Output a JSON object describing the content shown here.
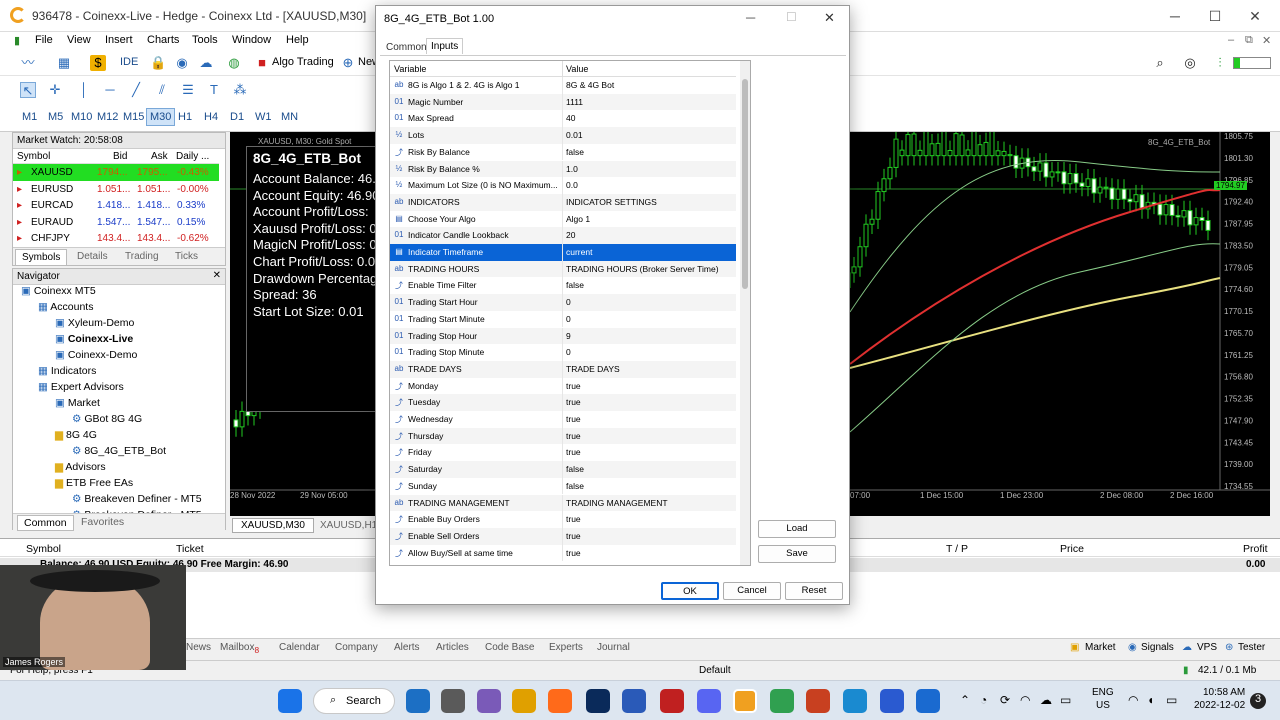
{
  "app": {
    "title": "936478 - Coinexx-Live - Hedge - Coinexx Ltd - [XAUUSD,M30]",
    "menu": [
      "File",
      "View",
      "Insert",
      "Charts",
      "Tools",
      "Window",
      "Help"
    ],
    "toolbar": {
      "algo_trading": "Algo Trading",
      "new_order": "New",
      "ide": "IDE"
    },
    "timeframes": [
      "M1",
      "M5",
      "M10",
      "M12",
      "M15",
      "M30",
      "H1",
      "H4",
      "D1",
      "W1",
      "MN"
    ],
    "active_timeframe": "M30"
  },
  "market_watch": {
    "title": "Market Watch: 20:58:08",
    "columns": [
      "Symbol",
      "Bid",
      "Ask",
      "Daily ..."
    ],
    "rows": [
      {
        "symbol": "XAUUSD",
        "bid": "1794...",
        "ask": "1795...",
        "daily": "-0.43%"
      },
      {
        "symbol": "EURUSD",
        "bid": "1.051...",
        "ask": "1.051...",
        "daily": "-0.00%"
      },
      {
        "symbol": "EURCAD",
        "bid": "1.418...",
        "ask": "1.418...",
        "daily": "0.33%"
      },
      {
        "symbol": "EURAUD",
        "bid": "1.547...",
        "ask": "1.547...",
        "daily": "0.15%"
      },
      {
        "symbol": "CHFJPY",
        "bid": "143.4...",
        "ask": "143.4...",
        "daily": "-0.62%"
      }
    ],
    "tabs": [
      "Symbols",
      "Details",
      "Trading",
      "Ticks"
    ]
  },
  "navigator": {
    "title": "Navigator",
    "items": [
      {
        "label": "Coinexx MT5",
        "level": 0
      },
      {
        "label": "Accounts",
        "level": 1
      },
      {
        "label": "Xyleum-Demo",
        "level": 2
      },
      {
        "label": "Coinexx-Live",
        "level": 2
      },
      {
        "label": "Coinexx-Demo",
        "level": 2
      },
      {
        "label": "Indicators",
        "level": 1
      },
      {
        "label": "Expert Advisors",
        "level": 1
      },
      {
        "label": "Market",
        "level": 2
      },
      {
        "label": "GBot 8G 4G",
        "level": 3
      },
      {
        "label": "8G 4G",
        "level": 2
      },
      {
        "label": "8G_4G_ETB_Bot",
        "level": 3
      },
      {
        "label": "Advisors",
        "level": 2
      },
      {
        "label": "ETB Free EAs",
        "level": 2
      },
      {
        "label": "Breakeven Definer - MT5",
        "level": 3
      },
      {
        "label": "Breakeven Definer - MT5",
        "level": 3
      }
    ],
    "tabs": [
      "Common",
      "Favorites"
    ]
  },
  "chart": {
    "symbol_label": "XAUUSD, M30: Gold Spot",
    "bot_label": "8G_4G_ETB_Bot",
    "current_price": "1794.97",
    "price_ticks": [
      "1805.75",
      "1801.30",
      "1796.85",
      "1792.40",
      "1787.95",
      "1783.50",
      "1779.05",
      "1774.60",
      "1770.15",
      "1765.70",
      "1761.25",
      "1756.80",
      "1752.35",
      "1747.90",
      "1743.45",
      "1739.00",
      "1734.55"
    ],
    "time_ticks": [
      "28 Nov 2022",
      "29 Nov 05:00",
      "07:00",
      "1 Dec 15:00",
      "1 Dec 23:00",
      "2 Dec 08:00",
      "2 Dec 16:00"
    ],
    "tabs": [
      "XAUUSD,M30",
      "XAUUSD,H1"
    ]
  },
  "overlay": {
    "title": "8G_4G_ETB_Bot",
    "lines": [
      "Account Balance: 46.",
      "Account Equity: 46.90",
      "Account Profit/Loss:",
      "Xauusd Profit/Loss: 0",
      "MagicN Profit/Loss: 0",
      "Chart Profit/Loss: 0.0",
      "Drawdown Percentag",
      "Spread: 36",
      "Start Lot Size: 0.01"
    ]
  },
  "terminal": {
    "columns": [
      "Symbol",
      "Ticket",
      "T / P",
      "Price",
      "Profit"
    ],
    "balance_line": "Balance: 46.90 USD  Equity: 46.90  Free Margin: 46.90",
    "profit_total": "0.00",
    "tabs": [
      "News",
      "Mailbox",
      "Calendar",
      "Company",
      "Alerts",
      "Articles",
      "Code Base",
      "Experts",
      "Journal"
    ],
    "mailbox_badge": "8",
    "right_items": [
      "Market",
      "Signals",
      "VPS",
      "Tester"
    ]
  },
  "status": {
    "left": "For Help, press F1",
    "center": "Default",
    "right": "42.1 / 0.1 Mb"
  },
  "webcam": {
    "name": "James Rogers"
  },
  "taskbar": {
    "search": "Search",
    "lang": "ENG",
    "region": "US",
    "time": "10:58 AM",
    "date": "2022-12-02"
  },
  "dialog": {
    "title": "8G_4G_ETB_Bot 1.00",
    "tabs": [
      "Common",
      "Inputs"
    ],
    "active_tab": "Inputs",
    "columns": [
      "Variable",
      "Value"
    ],
    "rows": [
      {
        "icon": "ab",
        "name": "8G is Algo 1 & 2. 4G is Algo 1",
        "value": "8G & 4G Bot"
      },
      {
        "icon": "01",
        "name": "Magic Number",
        "value": "1111"
      },
      {
        "icon": "01",
        "name": "Max Spread",
        "value": "40"
      },
      {
        "icon": "½",
        "name": "Lots",
        "value": "0.01"
      },
      {
        "icon": "⤴",
        "name": "Risk By Balance",
        "value": "false"
      },
      {
        "icon": "½",
        "name": "Risk By Balance %",
        "value": "1.0"
      },
      {
        "icon": "½",
        "name": "Maximum Lot Size (0 is NO Maximum...",
        "value": "0.0"
      },
      {
        "icon": "ab",
        "name": "INDICATORS",
        "value": "INDICATOR SETTINGS"
      },
      {
        "icon": "▤",
        "name": "Choose Your Algo",
        "value": "Algo 1"
      },
      {
        "icon": "01",
        "name": "Indicator Candle Lookback",
        "value": "20"
      },
      {
        "icon": "▤",
        "name": "Indicator Timeframe",
        "value": "current",
        "selected": true
      },
      {
        "icon": "ab",
        "name": "TRADING HOURS",
        "value": "TRADING HOURS (Broker Server Time)"
      },
      {
        "icon": "⤴",
        "name": "Enable Time Filter",
        "value": "false"
      },
      {
        "icon": "01",
        "name": "Trading Start Hour",
        "value": "0"
      },
      {
        "icon": "01",
        "name": "Trading Start Minute",
        "value": "0"
      },
      {
        "icon": "01",
        "name": "Trading Stop Hour",
        "value": "9"
      },
      {
        "icon": "01",
        "name": "Trading Stop Minute",
        "value": "0"
      },
      {
        "icon": "ab",
        "name": "TRADE DAYS",
        "value": "TRADE DAYS"
      },
      {
        "icon": "⤴",
        "name": "Monday",
        "value": "true"
      },
      {
        "icon": "⤴",
        "name": "Tuesday",
        "value": "true"
      },
      {
        "icon": "⤴",
        "name": "Wednesday",
        "value": "true"
      },
      {
        "icon": "⤴",
        "name": "Thursday",
        "value": "true"
      },
      {
        "icon": "⤴",
        "name": "Friday",
        "value": "true"
      },
      {
        "icon": "⤴",
        "name": "Saturday",
        "value": "false"
      },
      {
        "icon": "⤴",
        "name": "Sunday",
        "value": "false"
      },
      {
        "icon": "ab",
        "name": "TRADING MANAGEMENT",
        "value": "TRADING MANAGEMENT"
      },
      {
        "icon": "⤴",
        "name": "Enable Buy Orders",
        "value": "true"
      },
      {
        "icon": "⤴",
        "name": "Enable Sell Orders",
        "value": "true"
      },
      {
        "icon": "⤴",
        "name": "Allow Buy/Sell at same time",
        "value": "true"
      }
    ],
    "buttons": {
      "load": "Load",
      "save": "Save",
      "ok": "OK",
      "cancel": "Cancel",
      "reset": "Reset"
    }
  },
  "colors": {
    "selected": "#0a64d6",
    "positive": "#1a3cc8",
    "negative": "#d02020",
    "highlight_row": "#22dd22"
  }
}
